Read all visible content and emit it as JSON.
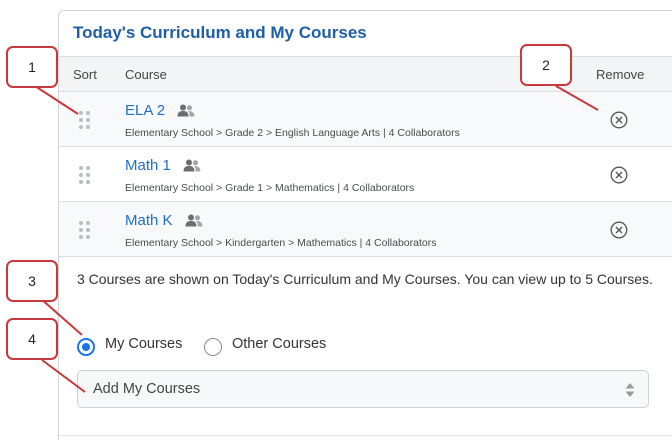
{
  "panel": {
    "title": "Today's Curriculum and My Courses",
    "columns": {
      "sort": "Sort",
      "course": "Course",
      "remove": "Remove"
    }
  },
  "courses": [
    {
      "name": "ELA 2",
      "path": "Elementary School > Grade 2 > English Language Arts | 4 Collaborators"
    },
    {
      "name": "Math 1",
      "path": "Elementary School > Grade 1 > Mathematics | 4 Collaborators"
    },
    {
      "name": "Math K",
      "path": "Elementary School > Kindergarten > Mathematics | 4 Collaborators"
    }
  ],
  "info_text": "3 Courses are shown on Today's Curriculum and My Courses. You can view up to 5 Courses.",
  "radio": {
    "options": [
      "My Courses",
      "Other Courses"
    ],
    "selected": "My Courses"
  },
  "select": {
    "value": "Add My Courses"
  },
  "callouts": [
    "1",
    "2",
    "3",
    "4"
  ],
  "icons": {
    "drag": "drag-handle-icon",
    "collaborators": "people-icon",
    "remove": "remove-circle-x-icon",
    "select_arrows": "up-down-arrows-icon"
  },
  "colors": {
    "title": "#1f5fa8",
    "link": "#1f6fc9",
    "radio": "#1a73e8",
    "callout_border": "#c8393d"
  }
}
